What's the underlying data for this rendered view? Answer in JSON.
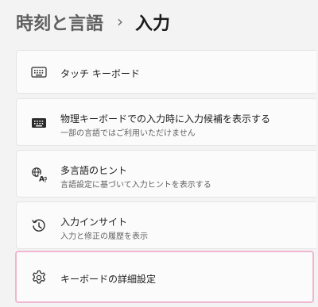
{
  "breadcrumb": {
    "parent": "時刻と言語",
    "separator": "›",
    "current": "入力"
  },
  "items": [
    {
      "icon": "keyboard-outline-icon",
      "title": "タッチ キーボード",
      "subtitle": ""
    },
    {
      "icon": "keyboard-filled-icon",
      "title": "物理キーボードでの入力時に入力候補を表示する",
      "subtitle": "一部の言語ではご利用いただけません"
    },
    {
      "icon": "multilingual-hint-icon",
      "title": "多言語のヒント",
      "subtitle": "言語設定に基づいて入力ヒントを表示する"
    },
    {
      "icon": "history-icon",
      "title": "入力インサイト",
      "subtitle": "入力と修正の履歴を表示"
    },
    {
      "icon": "gear-icon",
      "title": "キーボードの詳細設定",
      "subtitle": ""
    }
  ]
}
